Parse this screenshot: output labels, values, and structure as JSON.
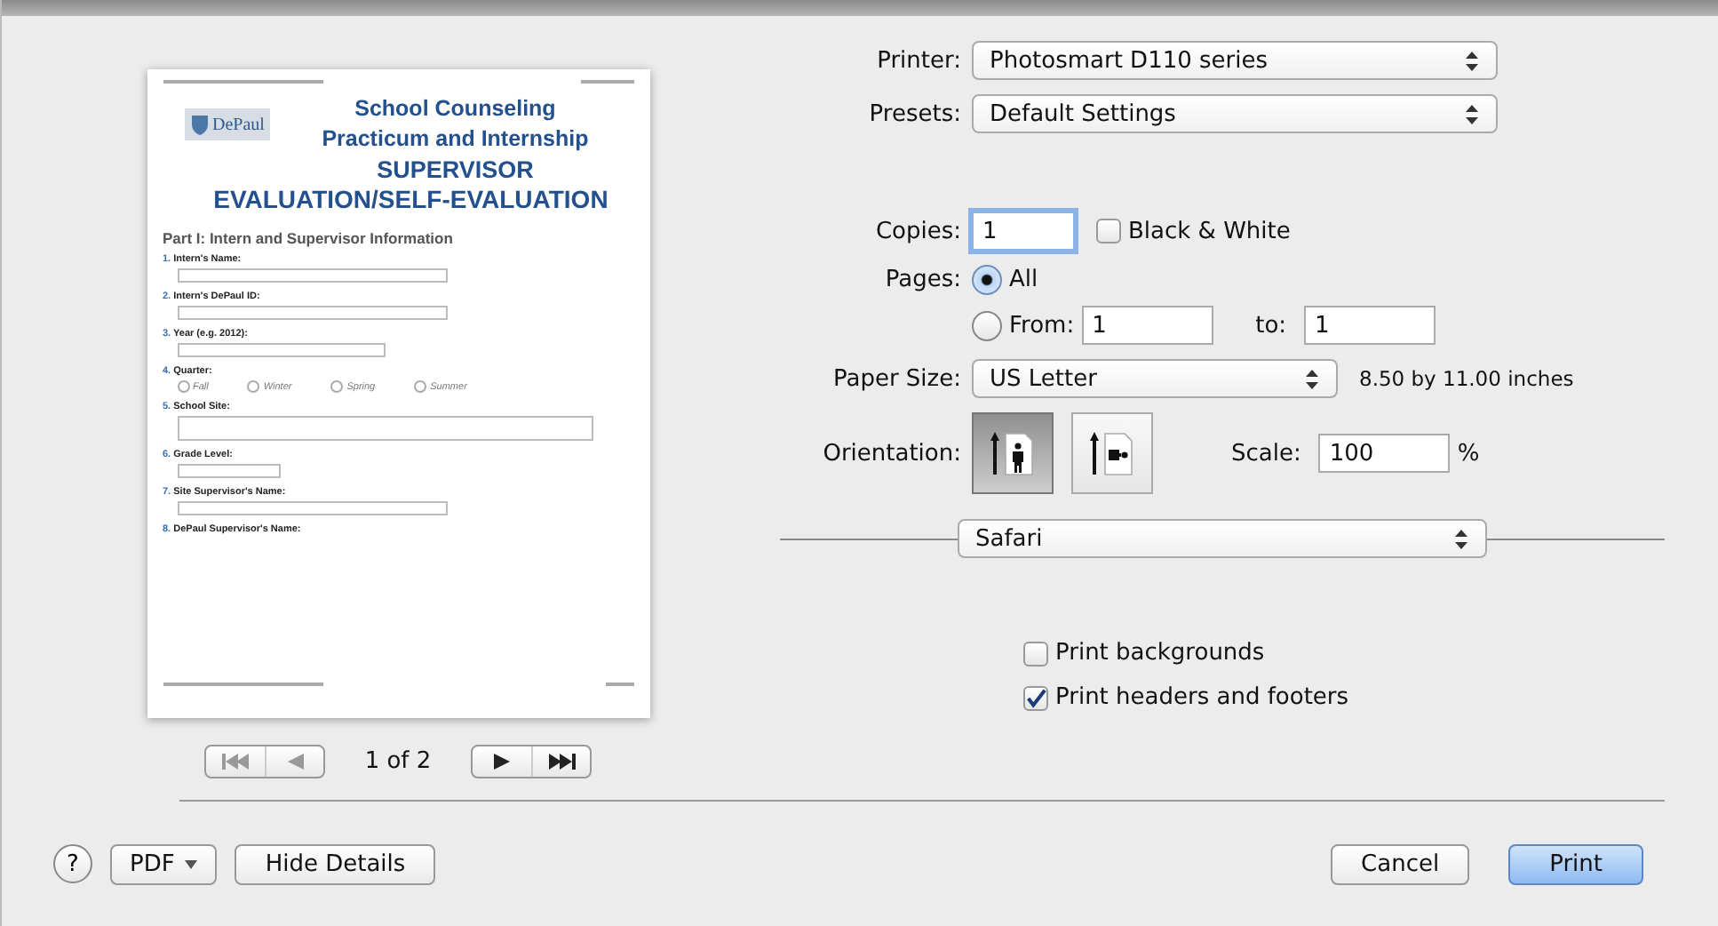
{
  "preview": {
    "logo": "DePaul",
    "title_lines": [
      "School Counseling",
      "Practicum and Internship",
      "SUPERVISOR",
      "EVALUATION/SELF-EVALUATION"
    ],
    "section_heading": "Part I: Intern and Supervisor Information",
    "questions": [
      {
        "number": "1.",
        "label": "Intern's Name:",
        "kind": "field"
      },
      {
        "number": "2.",
        "label": "Intern's DePaul ID:",
        "kind": "field"
      },
      {
        "number": "3.",
        "label": "Year (e.g. 2012):",
        "kind": "medium"
      },
      {
        "number": "4.",
        "label": "Quarter:",
        "kind": "radios",
        "options": [
          {
            "label": "Fall",
            "selected": false
          },
          {
            "label": "Winter",
            "selected": false
          },
          {
            "label": "Spring",
            "selected": false
          },
          {
            "label": "Summer",
            "selected": false
          }
        ]
      },
      {
        "number": "5.",
        "label": "School Site:",
        "kind": "area"
      },
      {
        "number": "6.",
        "label": "Grade Level:",
        "kind": "short"
      },
      {
        "number": "7.",
        "label": "Site Supervisor's Name:",
        "kind": "field"
      },
      {
        "number": "8.",
        "label": "DePaul Supervisor's Name:",
        "kind": "none"
      }
    ]
  },
  "page_nav": {
    "label": "1 of 2"
  },
  "settings": {
    "printer": {
      "label": "Printer:",
      "value": "Photosmart D110 series"
    },
    "presets": {
      "label": "Presets:",
      "value": "Default Settings"
    },
    "copies": {
      "label": "Copies:",
      "value": "1"
    },
    "black_white": {
      "label": "Black & White",
      "checked": false
    },
    "pages": {
      "label": "Pages:",
      "all": {
        "label": "All",
        "selected": true
      },
      "from": {
        "label": "From:",
        "selected": false,
        "value": "1"
      },
      "to": {
        "label": "to:",
        "value": "1"
      }
    },
    "paper_size": {
      "label": "Paper Size:",
      "value": "US Letter",
      "dimensions": "8.50 by 11.00 inches"
    },
    "orientation": {
      "label": "Orientation:",
      "options": [
        {
          "kind": "portrait",
          "selected": true
        },
        {
          "kind": "landscape",
          "selected": false
        }
      ]
    },
    "scale": {
      "label": "Scale:",
      "value": "100",
      "unit": "%"
    },
    "section": "Safari",
    "options": [
      {
        "label": "Print backgrounds",
        "checked": false
      },
      {
        "label": "Print headers and footers",
        "checked": true
      }
    ]
  },
  "buttons": {
    "help": "?",
    "pdf": "PDF",
    "details": "Hide Details",
    "cancel": "Cancel",
    "print": "Print"
  }
}
